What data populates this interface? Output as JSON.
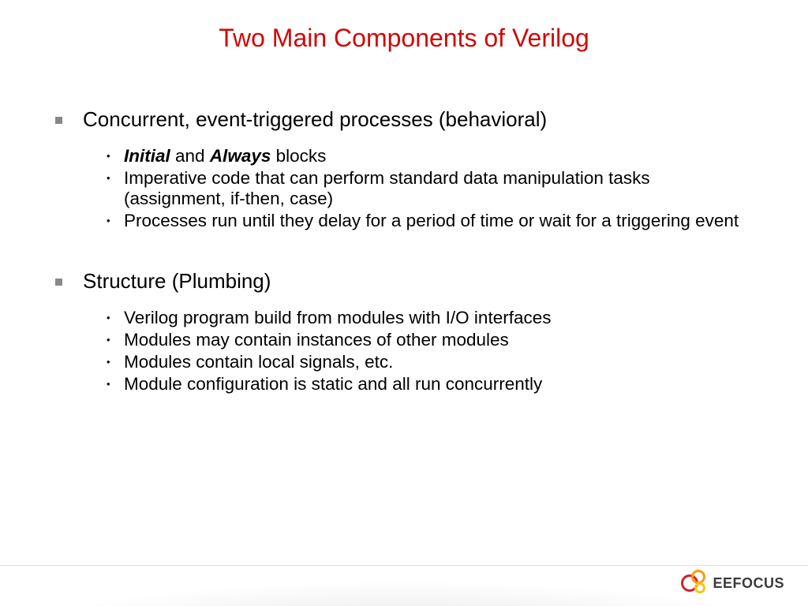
{
  "title": "Two Main Components of Verilog",
  "sections": [
    {
      "heading": "Concurrent, event-triggered processes (behavioral)",
      "items": [
        {
          "pre": "",
          "em1": "Initial",
          "mid": " and ",
          "em2": "Always",
          "post": " blocks"
        },
        {
          "pre": "Imperative code that can perform standard data manipulation tasks (assignment, if-then, case)",
          "em1": "",
          "mid": "",
          "em2": "",
          "post": ""
        },
        {
          "pre": "Processes run until they delay for a period of time or wait for a triggering event",
          "em1": "",
          "mid": "",
          "em2": "",
          "post": ""
        }
      ]
    },
    {
      "heading": "Structure (Plumbing)",
      "items": [
        {
          "pre": "Verilog program build from modules with I/O interfaces",
          "em1": "",
          "mid": "",
          "em2": "",
          "post": ""
        },
        {
          "pre": "Modules may contain instances of other modules",
          "em1": "",
          "mid": "",
          "em2": "",
          "post": ""
        },
        {
          "pre": "Modules contain local signals, etc.",
          "em1": "",
          "mid": "",
          "em2": "",
          "post": ""
        },
        {
          "pre": "Module configuration is static and all run concurrently",
          "em1": "",
          "mid": "",
          "em2": "",
          "post": ""
        }
      ]
    }
  ],
  "logo_text": "EEFOCUS"
}
